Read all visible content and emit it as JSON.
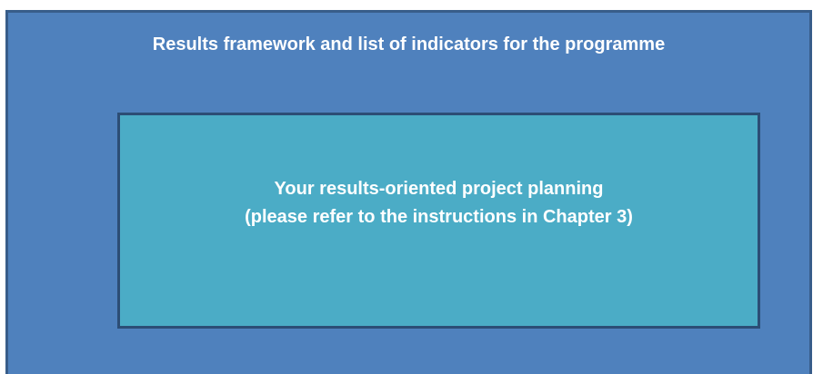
{
  "outer": {
    "title": "Results framework and list of indicators for the programme"
  },
  "inner": {
    "line1": "Your results-oriented project planning",
    "line2": "(please refer to the instructions in Chapter 3)"
  },
  "colors": {
    "outer_fill": "#4f81bd",
    "outer_border": "#385d8a",
    "inner_fill": "#4bacc6",
    "inner_border": "#2c4d75",
    "text": "#ffffff"
  }
}
